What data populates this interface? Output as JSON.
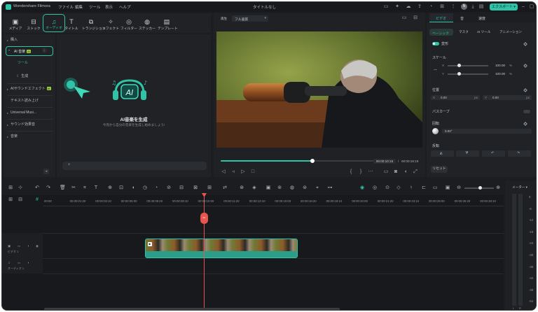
{
  "titlebar": {
    "app_name": "Wondershare Filmora",
    "menus": [
      "ファイル",
      "編集",
      "ツール",
      "表示",
      "ヘルプ"
    ],
    "doc_title": "タイトルなし",
    "avatar": "N",
    "export_label": "エクスポート ▾"
  },
  "toolbar": {
    "items": [
      {
        "label": "メディア",
        "icon": "media-icon"
      },
      {
        "label": "ストック",
        "icon": "stock-icon"
      },
      {
        "label": "オーディオ",
        "icon": "audio-icon"
      },
      {
        "label": "タイトル",
        "icon": "title-icon"
      },
      {
        "label": "トランジション",
        "icon": "transition-icon"
      },
      {
        "label": "エフェクト",
        "icon": "effect-icon"
      },
      {
        "label": "フィルター",
        "icon": "filter-icon"
      },
      {
        "label": "ステッカー",
        "icon": "sticker-icon"
      },
      {
        "label": "テンプレート",
        "icon": "template-icon"
      }
    ],
    "active": "オーディオ"
  },
  "library": {
    "items": [
      {
        "label": "購入"
      },
      {
        "label": "AI 音楽",
        "badge": "AI"
      },
      {
        "label": "ツール"
      },
      {
        "label": "生成"
      },
      {
        "label": "AIサウンドエフェクト",
        "badge": "AI"
      },
      {
        "label": "テキスト読み上げ"
      },
      {
        "label": "Universal Musi..."
      },
      {
        "label": "サウンド効果音"
      },
      {
        "label": "音楽"
      }
    ]
  },
  "ai_music": {
    "heading": "AI音楽を生成",
    "sub": "今売から自分の音楽を生成し始めましょう!",
    "badge_text": "AI"
  },
  "preview": {
    "quality_label": "再生",
    "quality_value": "フル画質",
    "time_current": "00:00:10:16",
    "time_total": "00:00:16:19",
    "progress": 0.6
  },
  "inspector": {
    "top_tabs": [
      "ビデオ",
      "音",
      "速度"
    ],
    "sub_tabs": [
      "ベーシック",
      "マスク",
      "AI ツール",
      "アニメーション"
    ],
    "transform": "変形",
    "scale": "スケール",
    "scale_x": "100.00",
    "scale_y": "100.00",
    "pct": "%",
    "position": "位置",
    "pos_x": "0.00",
    "pos_y": "0.00",
    "px": "px",
    "x": "X",
    "y": "Y",
    "perspective": "パスカーブ",
    "rotate": "回転",
    "rotate_value": "0.00°",
    "flip": "反転",
    "reset": "リセット"
  },
  "timeline": {
    "ruler": [
      "00:00",
      "00:00:01:20",
      "00:00:03:10",
      "00:00:05:00",
      "00:00:06:20",
      "00:00:08:10",
      "00:00:10:00",
      "00:00:11:20",
      "00:00:13:10",
      "00:00:15:00",
      "00:00:16:20",
      "00:00:18:10",
      "00:00:20:00",
      "00:00:21:20",
      "00:00:23:10",
      "00:00:25:00",
      "00:00:26:20",
      "00:00:28:10"
    ],
    "track_video": "ビデオ 1",
    "track_audio": "オーディオ 1",
    "meter_label": "メーター ▾",
    "db": [
      "0",
      "-6",
      "-12",
      "-18",
      "-24",
      "-30",
      "-36",
      "-42",
      "-48",
      "-54"
    ],
    "lr": [
      "L",
      "R"
    ]
  },
  "colors": {
    "accent": "#2fc4a8",
    "playhead": "#e8554e",
    "bg": "#1b1d21"
  }
}
